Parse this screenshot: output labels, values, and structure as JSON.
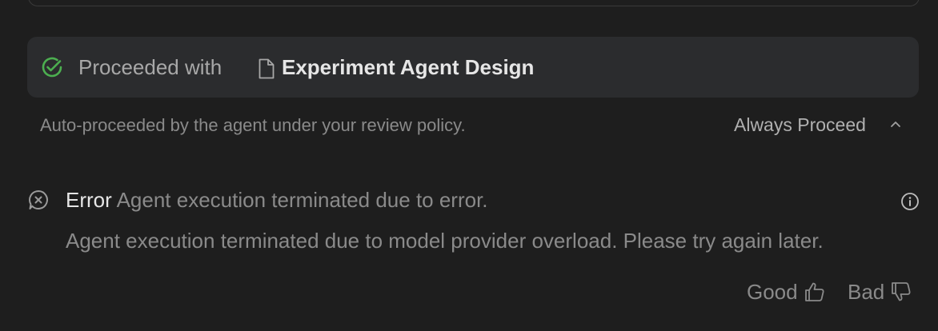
{
  "proceed": {
    "prefix": "Proceeded with",
    "document_title": "Experiment Agent Design",
    "status_icon": "check-circle-icon",
    "doc_icon": "document-icon"
  },
  "policy": {
    "description": "Auto-proceeded by the agent under your review policy.",
    "mode_label": "Always Proceed",
    "toggle_icon": "chevron-up-icon"
  },
  "error": {
    "label": "Error",
    "summary": "Agent execution terminated due to error.",
    "detail": "Agent execution terminated due to model provider overload. Please try again later.",
    "icon": "error-bubble-icon",
    "info_icon": "info-icon"
  },
  "feedback": {
    "good_label": "Good",
    "bad_label": "Bad",
    "good_icon": "thumbs-up-icon",
    "bad_icon": "thumbs-down-icon"
  },
  "colors": {
    "background": "#1e1e1e",
    "card": "#2b2c2e",
    "success": "#4caf50",
    "muted_text": "#8a8a8a",
    "strong_text": "#e6e6e6"
  }
}
